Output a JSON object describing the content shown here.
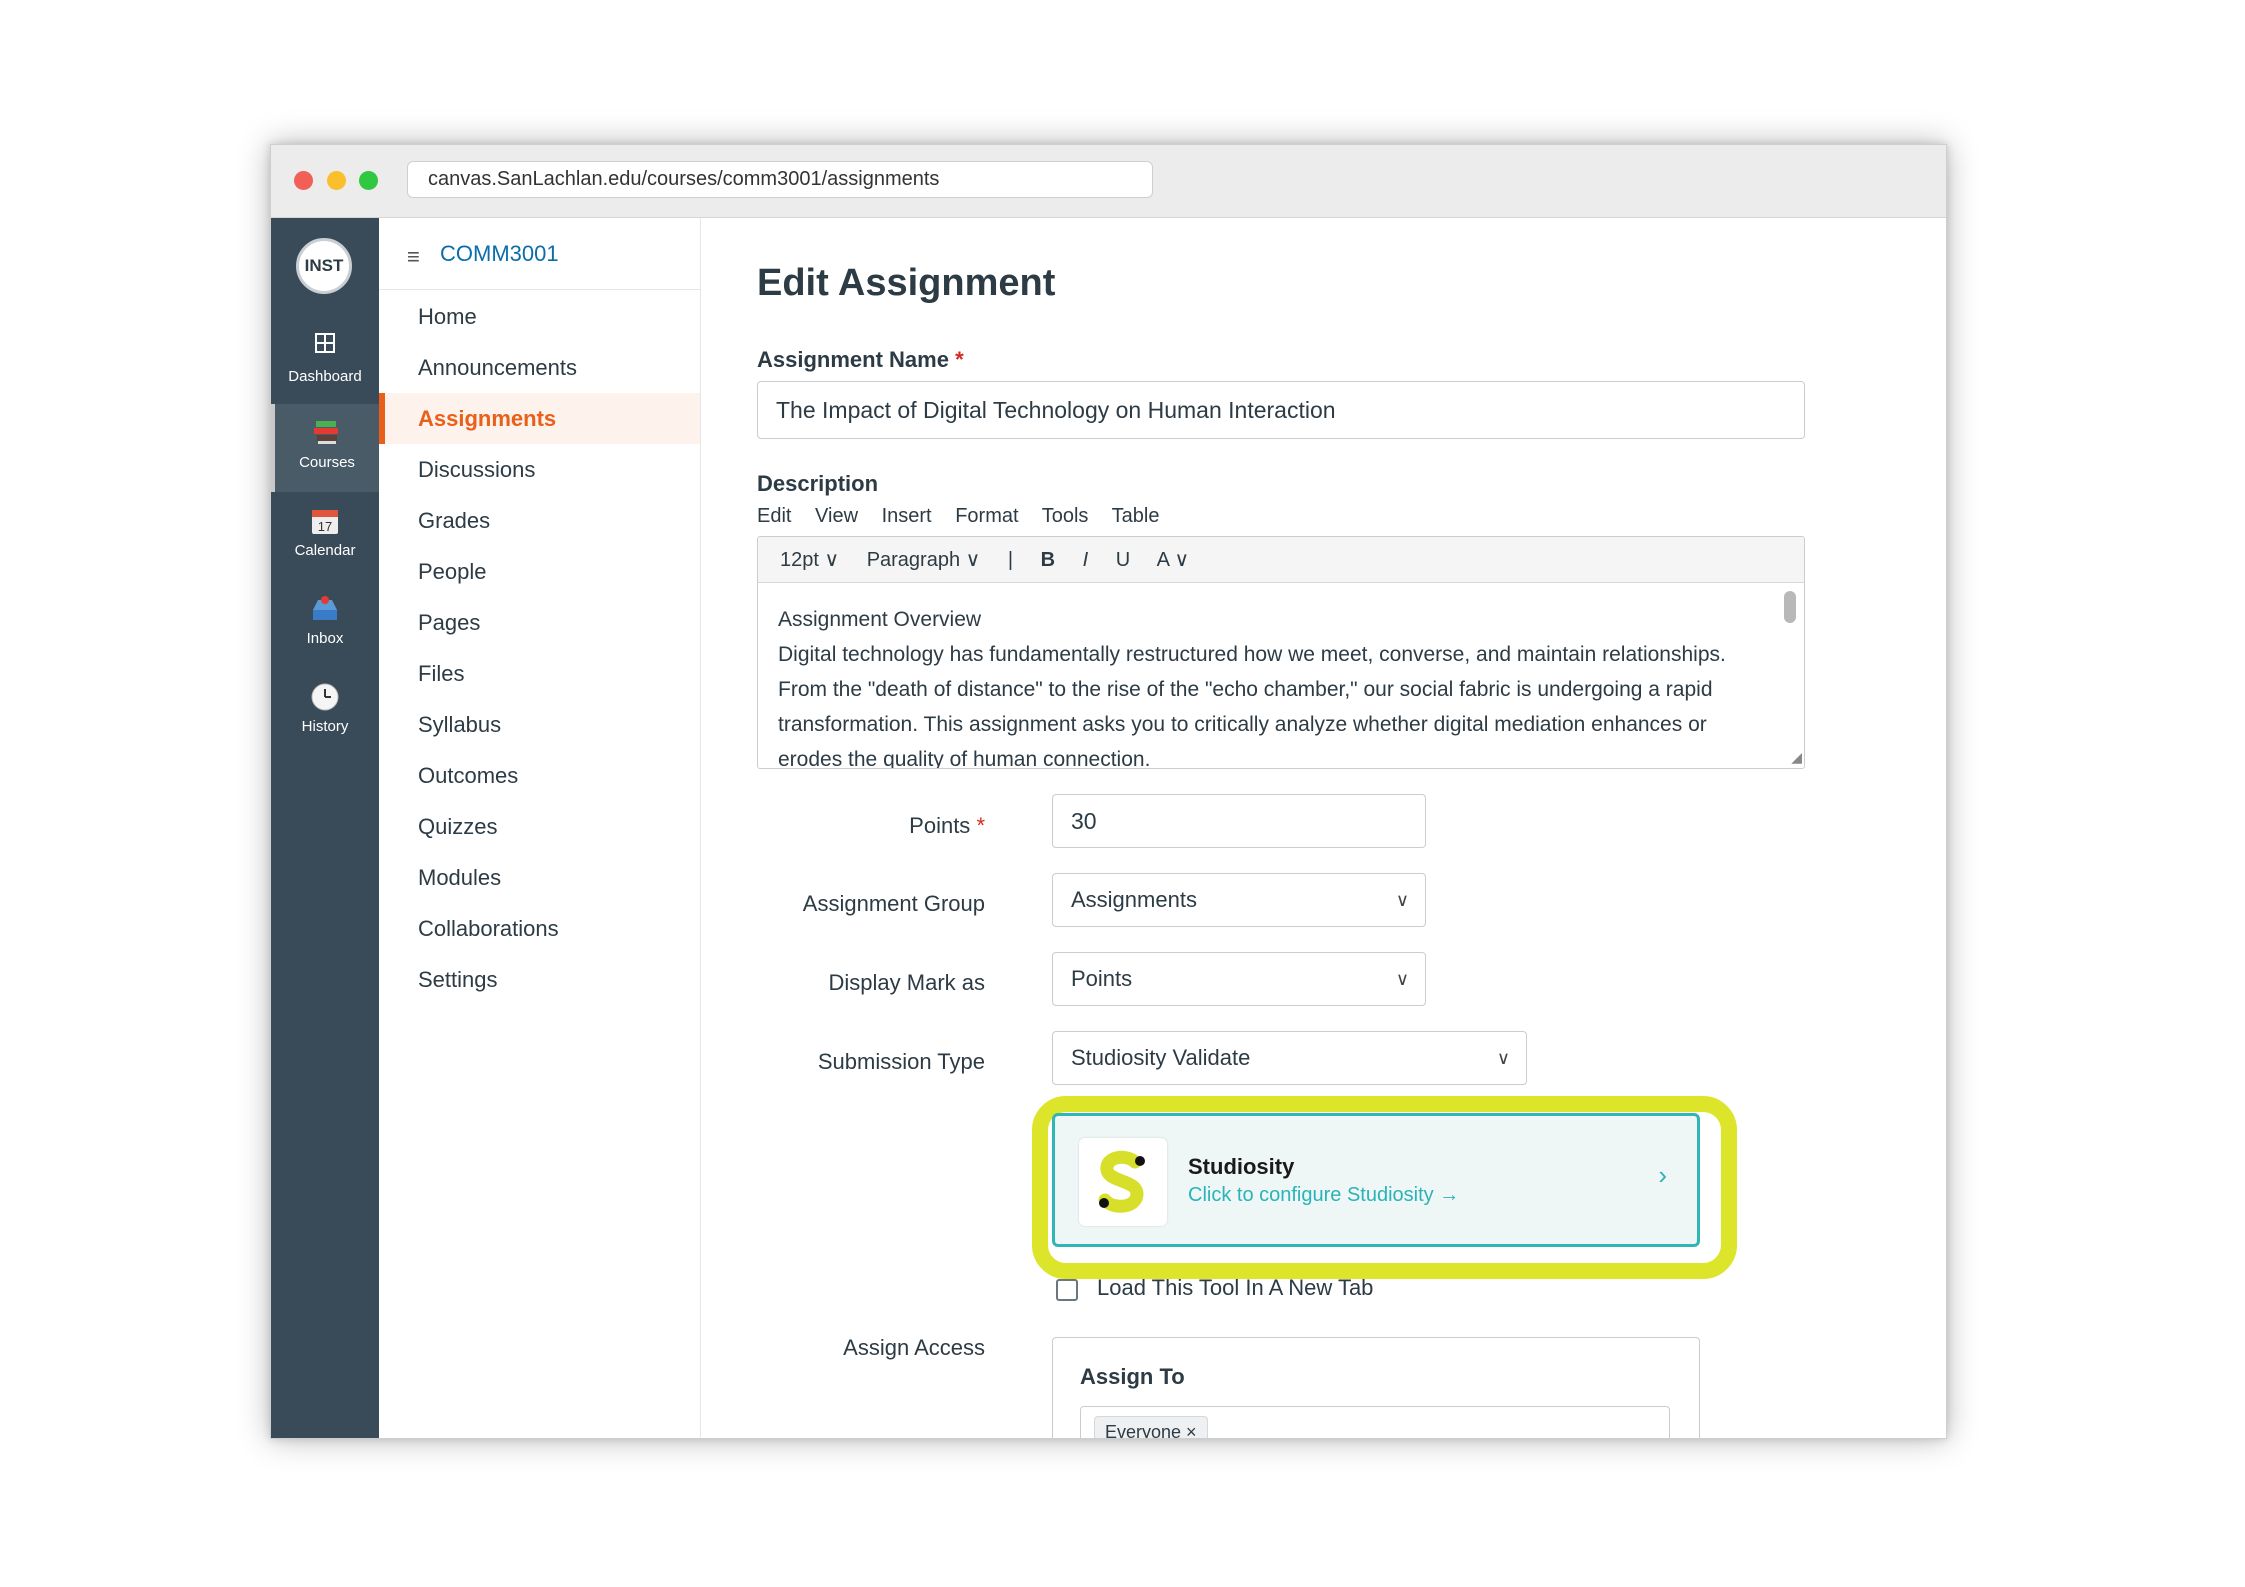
{
  "browser": {
    "url": "canvas.SanLachlan.edu/courses/comm3001/assignments"
  },
  "global_nav": {
    "logo": "INST",
    "items": [
      {
        "label": "Dashboard",
        "icon": "dashboard-icon"
      },
      {
        "label": "Courses",
        "icon": "courses-icon",
        "active": true
      },
      {
        "label": "Calendar",
        "icon": "calendar-icon"
      },
      {
        "label": "Inbox",
        "icon": "inbox-icon"
      },
      {
        "label": "History",
        "icon": "history-icon"
      }
    ]
  },
  "course_nav": {
    "course_code": "COMM3001",
    "items": [
      "Home",
      "Announcements",
      "Assignments",
      "Discussions",
      "Grades",
      "People",
      "Pages",
      "Files",
      "Syllabus",
      "Outcomes",
      "Quizzes",
      "Modules",
      "Collaborations",
      "Settings"
    ],
    "active": "Assignments"
  },
  "form": {
    "title": "Edit Assignment",
    "name_label": "Assignment Name",
    "required_mark": "*",
    "name_value": "The Impact of Digital Technology on Human Interaction",
    "description_label": "Description",
    "editor_menu": [
      "Edit",
      "View",
      "Insert",
      "Format",
      "Tools",
      "Table"
    ],
    "toolbar": {
      "font_size": "12pt ∨",
      "block": "Paragraph ∨",
      "sep": "|",
      "bold": "B",
      "italic": "I",
      "underline": "U",
      "color": "A ∨"
    },
    "description_heading": "Assignment Overview",
    "description_text": "Digital technology has fundamentally restructured how we meet, converse, and maintain relationships. From the \"death of distance\" to the rise of the \"echo chamber,\" our social fabric is undergoing a rapid transformation. This assignment asks you to critically analyze whether digital mediation enhances or erodes the quality of human connection.",
    "points_label": "Points",
    "points_value": "30",
    "group_label": "Assignment Group",
    "group_value": "Assignments",
    "display_label": "Display Mark as",
    "display_value": "Points",
    "submission_label": "Submission Type",
    "submission_value": "Studiosity Validate",
    "chevron": "∨",
    "tool": {
      "name": "Studiosity",
      "link": "Click to configure Studiosity →",
      "chevron": "›",
      "highlight_color": "#dde52a",
      "accent_color": "#2bb3b8"
    },
    "new_tab_label": "Load This Tool In A New Tab",
    "assign_access_label": "Assign Access",
    "assign_to_label": "Assign To",
    "assign_tag": "Everyone ×"
  }
}
